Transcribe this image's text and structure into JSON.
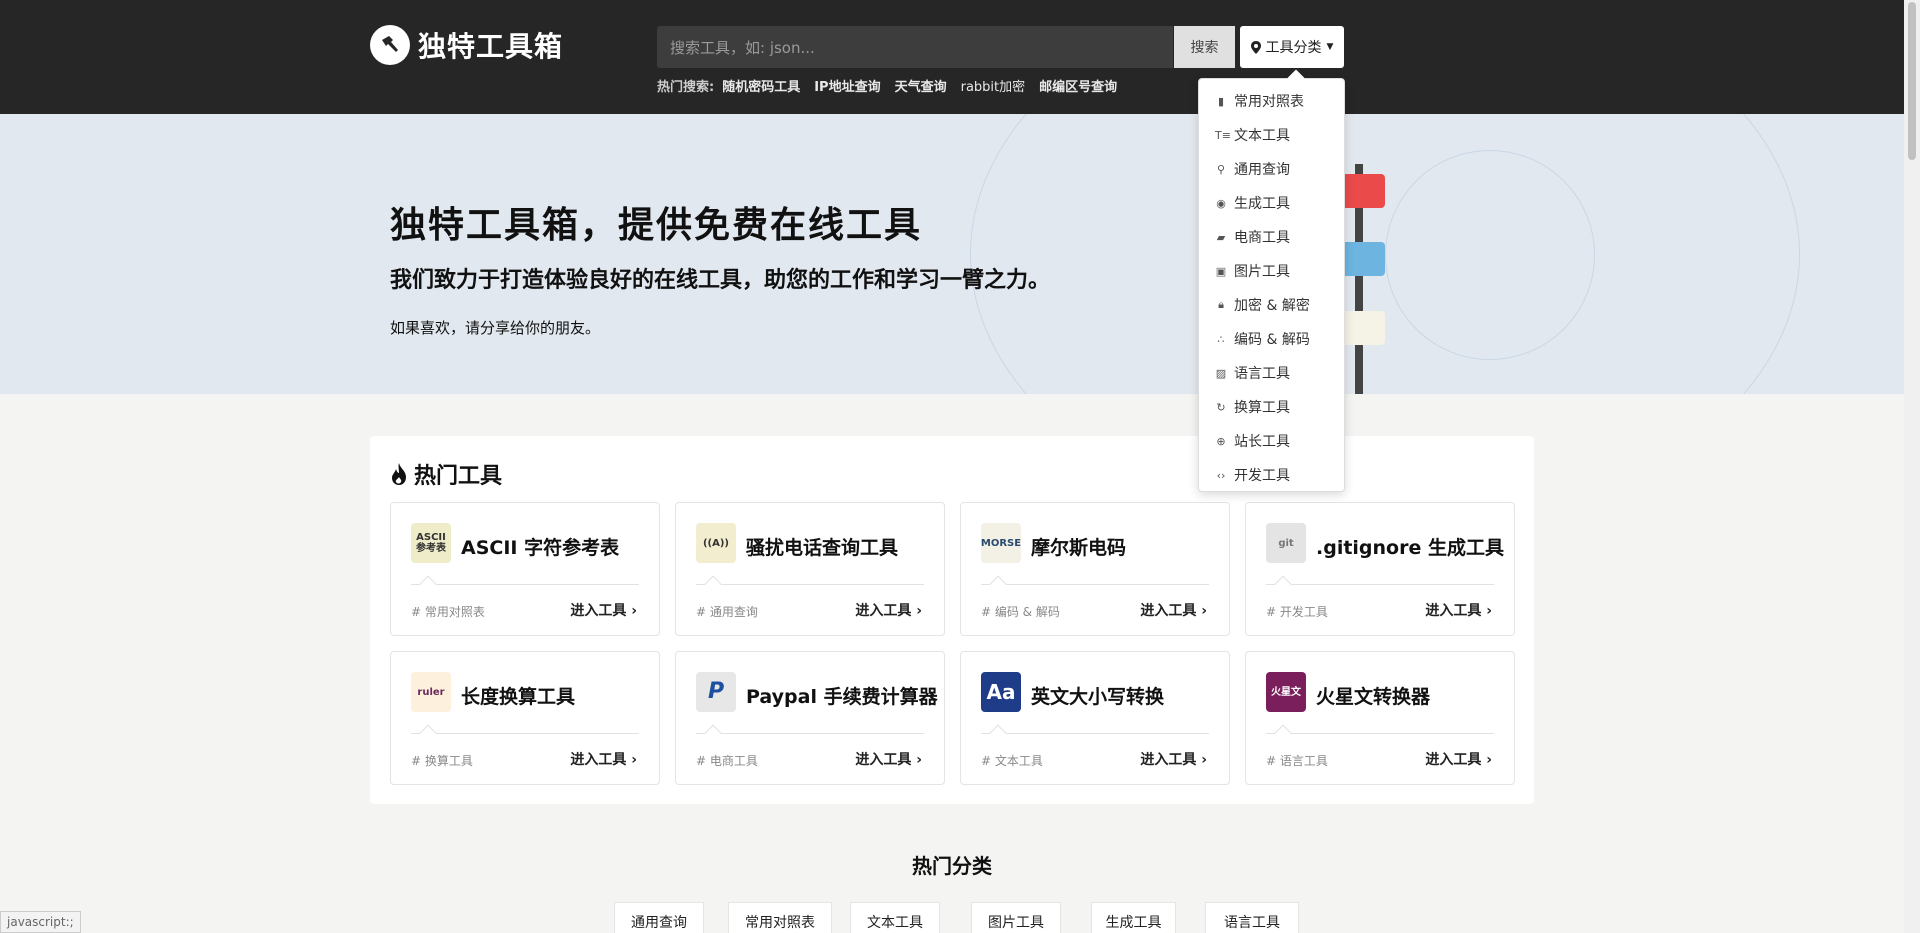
{
  "brand": {
    "name": "独特工具箱"
  },
  "search": {
    "placeholder": "搜索工具，如: json...",
    "button_label": "搜索"
  },
  "category_button": {
    "label": "工具分类"
  },
  "hot_search": {
    "label": "热门搜索:",
    "items": [
      "随机密码工具",
      "IP地址查询",
      "天气查询",
      "rabbit加密",
      "邮编区号查询"
    ]
  },
  "hero": {
    "title": "独特工具箱，提供免费在线工具",
    "subtitle": "我们致力于打造体验良好的在线工具，助您的工作和学习一臂之力。",
    "note": "如果喜欢，请分享给你的朋友。"
  },
  "dropdown": {
    "items": [
      {
        "label": "常用对照表",
        "icon": "book-icon"
      },
      {
        "label": "文本工具",
        "icon": "text-icon"
      },
      {
        "label": "通用查询",
        "icon": "search-icon"
      },
      {
        "label": "生成工具",
        "icon": "target-icon"
      },
      {
        "label": "电商工具",
        "icon": "truck-icon"
      },
      {
        "label": "图片工具",
        "icon": "image-icon"
      },
      {
        "label": "加密 & 解密",
        "icon": "lock-icon"
      },
      {
        "label": "编码 & 解码",
        "icon": "nodes-icon"
      },
      {
        "label": "语言工具",
        "icon": "translate-icon"
      },
      {
        "label": "换算工具",
        "icon": "refresh-icon"
      },
      {
        "label": "站长工具",
        "icon": "globe-icon"
      },
      {
        "label": "开发工具",
        "icon": "code-icon"
      }
    ]
  },
  "hot_tools": {
    "title": "热门工具",
    "enter_label": "进入工具",
    "cards": [
      {
        "title": "ASCII 字符参考表",
        "tag": "# 常用对照表",
        "icon_text": "ASCII\n参考表",
        "icon_bg": "#efedc9",
        "icon_color": "#333"
      },
      {
        "title": "骚扰电话查询工具",
        "tag": "# 通用查询",
        "icon_text": "((A))",
        "icon_bg": "#f1edce",
        "icon_color": "#333"
      },
      {
        "title": "摩尔斯电码",
        "tag": "# 编码 & 解码",
        "icon_text": "MORSE",
        "icon_bg": "#f3f1e6",
        "icon_color": "#2b4a6e"
      },
      {
        "title": ".gitignore 生成工具",
        "tag": "# 开发工具",
        "icon_text": "git",
        "icon_bg": "#e4e4e4",
        "icon_color": "#777"
      },
      {
        "title": "长度换算工具",
        "tag": "# 换算工具",
        "icon_text": "ruler",
        "icon_bg": "#fdf0dc",
        "icon_color": "#6b2a5e"
      },
      {
        "title": "Paypal 手续费计算器",
        "tag": "# 电商工具",
        "icon_text": "P",
        "icon_bg": "#e7e7e7",
        "icon_color": "#1e4fa0"
      },
      {
        "title": "英文大小写转换",
        "tag": "# 文本工具",
        "icon_text": "Aa",
        "icon_bg": "#1f3c88",
        "icon_color": "#ffffff"
      },
      {
        "title": "火星文转换器",
        "tag": "# 语言工具",
        "icon_text": "火星文",
        "icon_bg": "#7a1e5c",
        "icon_color": "#ffffff"
      }
    ]
  },
  "hot_categories": {
    "title": "热门分类",
    "items": [
      "通用查询",
      "常用对照表",
      "文本工具",
      "图片工具",
      "生成工具",
      "语言工具"
    ]
  },
  "status_bar": {
    "text": "javascript:;"
  },
  "colors": {
    "topbar": "#262626",
    "hero_bg": "#e2e8ef",
    "page_bg": "#f4f4f2",
    "accent_red": "#e84b4b"
  }
}
